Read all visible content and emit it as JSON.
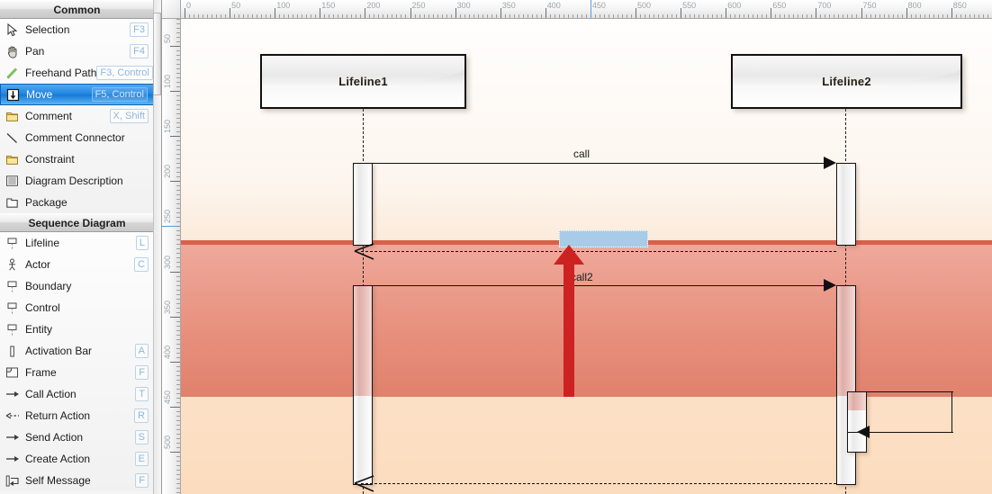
{
  "palette": {
    "groups": [
      {
        "title": "Common",
        "items": [
          {
            "label": "Selection",
            "key": "F3",
            "icon": "cursor-arrow-icon"
          },
          {
            "label": "Pan",
            "key": "F4",
            "icon": "hand-icon"
          },
          {
            "label": "Freehand Path",
            "key": "F3, Control",
            "icon": "pencil-icon"
          },
          {
            "label": "Move",
            "key": "F5, Control",
            "icon": "move-down-icon",
            "selected": true
          },
          {
            "label": "Comment",
            "key": "X, Shift",
            "icon": "note-icon"
          },
          {
            "label": "Comment Connector",
            "key": "",
            "icon": "diagonal-line-icon"
          },
          {
            "label": "Constraint",
            "key": "",
            "icon": "note-icon"
          },
          {
            "label": "Diagram Description",
            "key": "",
            "icon": "lines-document-icon"
          },
          {
            "label": "Package",
            "key": "",
            "icon": "package-icon"
          }
        ]
      },
      {
        "title": "Sequence Diagram",
        "items": [
          {
            "label": "Lifeline",
            "key": "L",
            "icon": "lifeline-icon"
          },
          {
            "label": "Actor",
            "key": "C",
            "icon": "actor-stickman-icon"
          },
          {
            "label": "Boundary",
            "key": "",
            "icon": "lifeline-icon"
          },
          {
            "label": "Control",
            "key": "",
            "icon": "lifeline-icon"
          },
          {
            "label": "Entity",
            "key": "",
            "icon": "lifeline-icon"
          },
          {
            "label": "Activation Bar",
            "key": "A",
            "icon": "activation-bar-icon"
          },
          {
            "label": "Frame",
            "key": "F",
            "icon": "frame-icon"
          },
          {
            "label": "Call Action",
            "key": "T",
            "icon": "arrow-right-solid-icon"
          },
          {
            "label": "Return Action",
            "key": "R",
            "icon": "arrow-left-dashed-icon"
          },
          {
            "label": "Send Action",
            "key": "S",
            "icon": "arrow-right-solid-icon"
          },
          {
            "label": "Create Action",
            "key": "E",
            "icon": "arrow-right-solid-icon"
          },
          {
            "label": "Self Message",
            "key": "F",
            "icon": "self-message-icon"
          }
        ]
      }
    ]
  },
  "rulers": {
    "horizontal": {
      "labels": [
        "0",
        "50",
        "100",
        "150",
        "200",
        "250",
        "300",
        "350",
        "400",
        "450",
        "500",
        "550",
        "600",
        "650",
        "700",
        "750",
        "800",
        "850"
      ],
      "cursor_value": "450"
    },
    "vertical": {
      "labels": [
        "50",
        "100",
        "150",
        "200",
        "250",
        "300",
        "350",
        "400",
        "450",
        "500"
      ],
      "cursor_value": "250"
    }
  },
  "diagram": {
    "lifelines": [
      {
        "name": "Lifeline1"
      },
      {
        "name": "Lifeline2"
      }
    ],
    "messages": [
      {
        "label": "call",
        "kind": "call"
      },
      {
        "label": "",
        "kind": "return"
      },
      {
        "label": "call2",
        "kind": "call"
      },
      {
        "label": "",
        "kind": "self"
      },
      {
        "label": "",
        "kind": "return"
      }
    ]
  },
  "colors": {
    "selection_blue": "#1e83e0",
    "drag_band": "#e8917f",
    "drag_band_edge": "#d9604a",
    "move_arrow": "#cc2222",
    "drop_indicator": "#a8cbe8",
    "canvas_bottom": "#fcdcbe"
  }
}
